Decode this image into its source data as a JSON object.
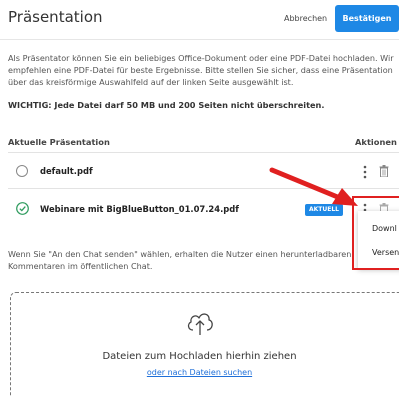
{
  "header": {
    "title": "Präsentation",
    "cancel_label": "Abbrechen",
    "confirm_label": "Bestätigen"
  },
  "info_text": "Als Präsentator können Sie ein beliebiges Office-Dokument oder eine PDF-Datei hochladen. Wir empfehlen eine PDF-Datei für beste Ergebnisse. Bitte stellen Sie sicher, dass eine Präsentation über das kreisförmige Auswahlfeld auf der linken Seite ausgewählt ist.",
  "warning_text": "WICHTIG: Jede Datei darf 50 MB und 200 Seiten nicht überschreiten.",
  "table": {
    "col_current": "Aktuelle Präsentation",
    "col_actions": "Aktionen",
    "rows": [
      {
        "filename": "default.pdf",
        "selected": false
      },
      {
        "filename": "Webinare mit BigBlueButton_01.07.24.pdf",
        "selected": true,
        "badge": "AKTUELL"
      }
    ]
  },
  "menu": {
    "items": [
      "Downl",
      "Versen"
    ]
  },
  "chat_note": "Wenn Sie \"An den Chat senden\" wählen, erhalten die Nutzer einen herunterladbaren Kommentaren im öffentlichen Chat.",
  "dropzone": {
    "icon": "cloud-upload-icon",
    "text": "Dateien zum Hochladen hierhin ziehen",
    "link": "oder nach Dateien suchen"
  },
  "colors": {
    "accent": "#1e88e5",
    "annotation": "#e02020",
    "link": "#1e6fd9",
    "check": "#2e9b5e"
  }
}
